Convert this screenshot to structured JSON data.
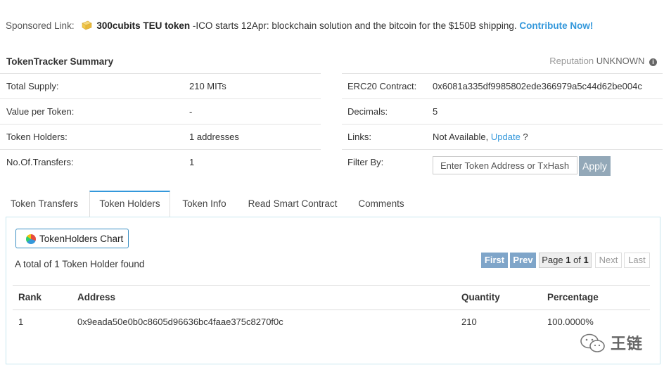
{
  "sponsored": {
    "label": "Sponsored Link:",
    "name": "300cubits TEU token",
    "text": " -ICO starts 12Apr: blockchain solution and the bitcoin for the $150B shipping. ",
    "cta": "Contribute Now!"
  },
  "summary": {
    "title": "TokenTracker Summary",
    "reputation_label": "Reputation",
    "reputation_value": "UNKNOWN"
  },
  "left_rows": [
    {
      "key": "Total Supply:",
      "value": "210 MITs"
    },
    {
      "key": "Value per Token:",
      "value": "-"
    },
    {
      "key": "Token Holders:",
      "value": "1 addresses"
    },
    {
      "key": "No.Of.Transfers:",
      "value": "1"
    }
  ],
  "right_rows": {
    "contract_key": "ERC20 Contract:",
    "contract_value": "0x6081a335df9985802ede366979a5c44d62be004c",
    "decimals_key": "Decimals:",
    "decimals_value": "5",
    "links_key": "Links:",
    "links_prefix": "Not Available, ",
    "links_update": "Update",
    "links_suffix": " ?",
    "filter_key": "Filter By:",
    "filter_placeholder": "Enter Token Address or TxHash",
    "apply_label": "Apply"
  },
  "tabs": [
    {
      "label": "Token Transfers"
    },
    {
      "label": "Token Holders"
    },
    {
      "label": "Token Info"
    },
    {
      "label": "Read Smart Contract"
    },
    {
      "label": "Comments"
    }
  ],
  "holders": {
    "chart_button": "TokenHolders Chart",
    "total_text": "A total of 1 Token Holder found",
    "pager": {
      "first": "First",
      "prev": "Prev",
      "page_word": "Page",
      "page_current": "1",
      "page_of": "of",
      "page_total": "1",
      "next": "Next",
      "last": "Last"
    },
    "columns": [
      "Rank",
      "Address",
      "Quantity",
      "Percentage"
    ],
    "rows": [
      {
        "rank": "1",
        "address": "0x9eada50e0b0c8605d96636bc4faae375c8270f0c",
        "quantity": "210",
        "percentage": "100.0000%"
      }
    ]
  },
  "watermark": {
    "text": "王链"
  },
  "colors": {
    "link": "#3498db",
    "pager_active": "#7fa5c9",
    "apply": "#93a8b8",
    "tab_accent": "#3498db"
  },
  "icons": [
    "cube-icon",
    "info-icon",
    "pie-chart-icon",
    "wechat-icon"
  ]
}
